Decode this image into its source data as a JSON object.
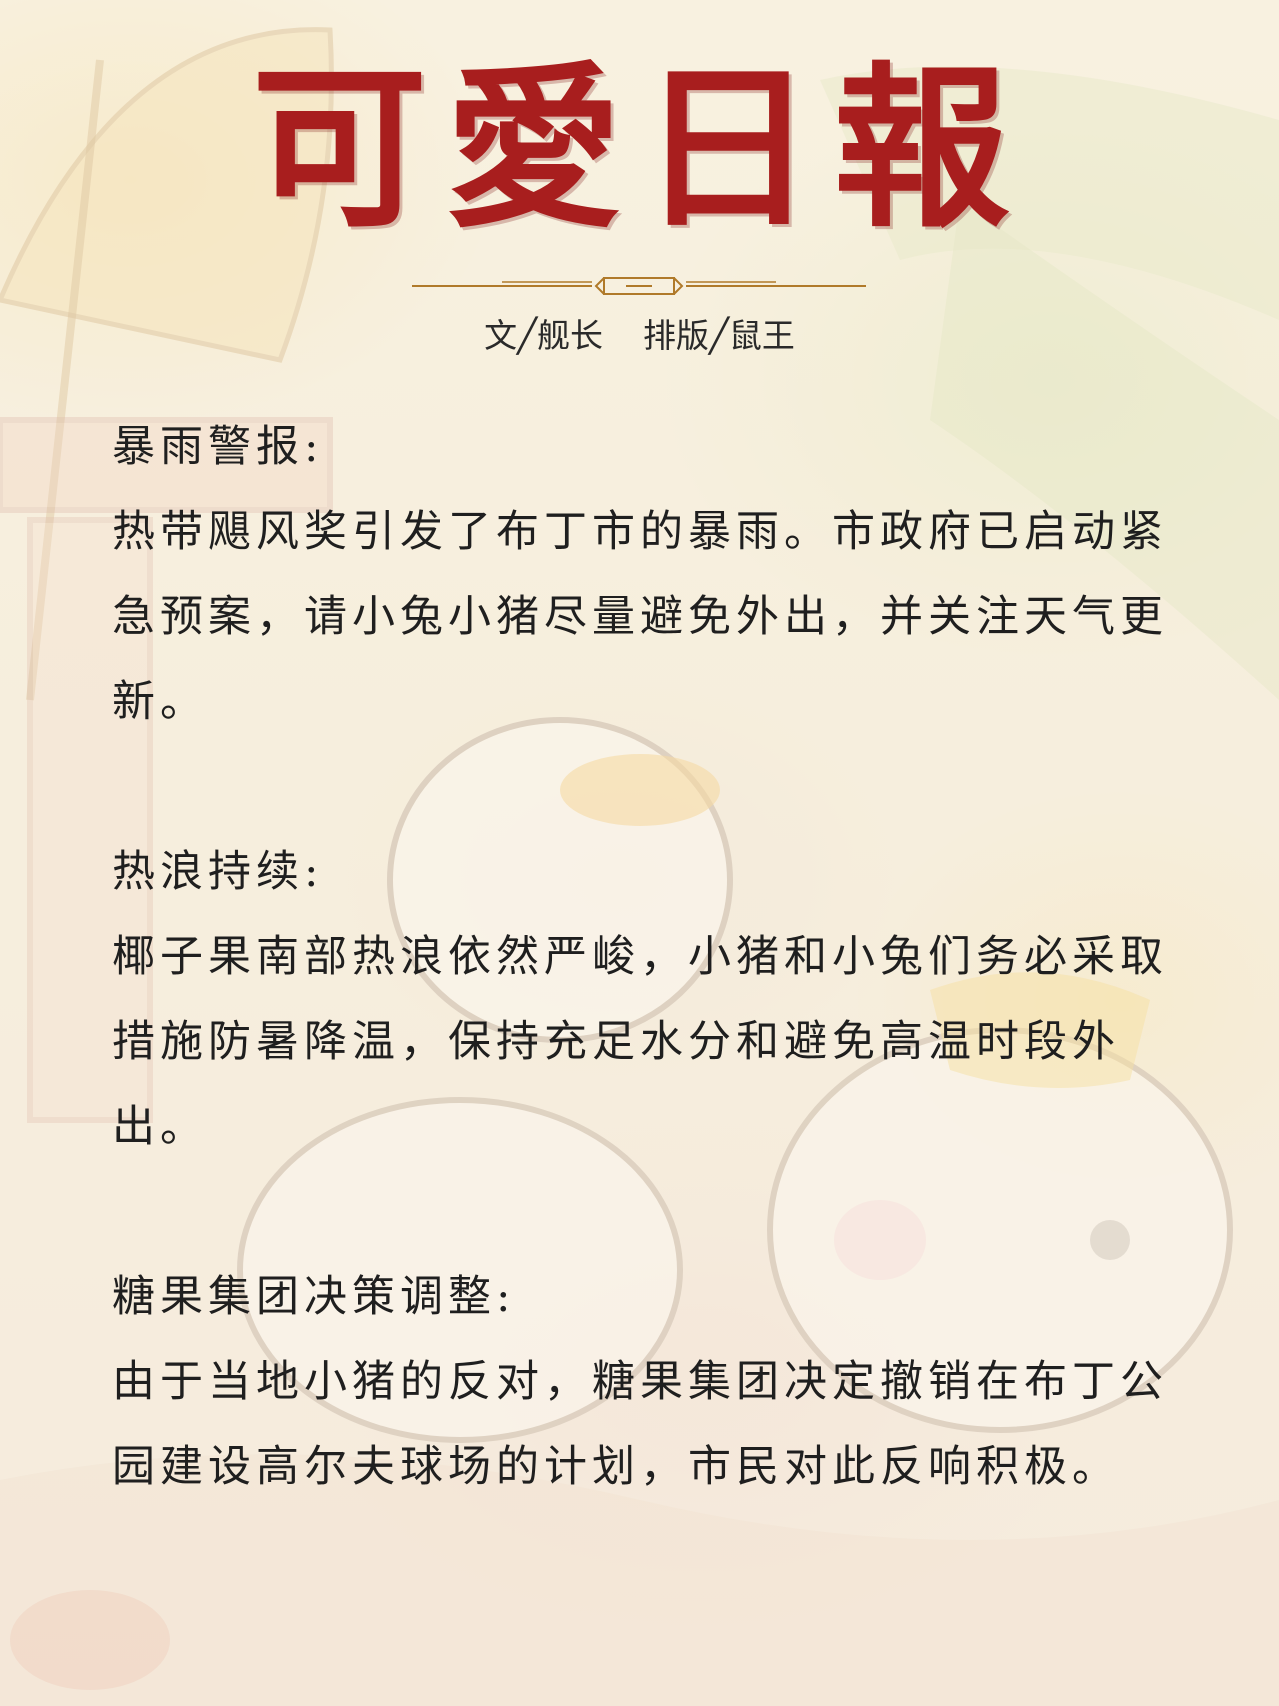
{
  "masthead": {
    "title": "可愛日報",
    "author": "文╱舰长",
    "layout": "排版╱鼠王"
  },
  "sections": [
    {
      "heading": "暴雨警报:",
      "body": "热带飓风奖引发了布丁市的暴雨。市政府已启动紧急预案，请小兔小猪尽量避免外出，并关注天气更新。"
    },
    {
      "heading": "热浪持续:",
      "body": "椰子果南部热浪依然严峻，小猪和小兔们务必采取措施防暑降温，保持充足水分和避免高温时段外出。"
    },
    {
      "heading": "糖果集团决策调整:",
      "body": "由于当地小猪的反对，糖果集团决定撤销在布丁公园建设高尔夫球场的计划，市民对此反响积极。"
    }
  ],
  "colors": {
    "title": "#a81e1e",
    "divider": "#b07a2a",
    "text": "#1f1f1f"
  }
}
